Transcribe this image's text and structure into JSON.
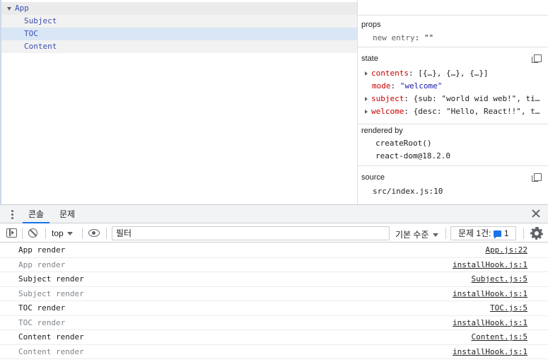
{
  "tree": {
    "root": "App",
    "children": [
      "Subject",
      "TOC",
      "Content"
    ],
    "selected": "TOC"
  },
  "inspector": {
    "props": {
      "title": "props",
      "entries": [
        {
          "key": "new entry",
          "value": "\"\""
        }
      ]
    },
    "state": {
      "title": "state",
      "entries": [
        {
          "key": "contents",
          "value": "[{…}, {…}, {…}]",
          "expandable": true
        },
        {
          "key": "mode",
          "value": "\"welcome\"",
          "expandable": false
        },
        {
          "key": "subject",
          "value": "{sub: \"world wid web!\", title:…",
          "expandable": true
        },
        {
          "key": "welcome",
          "value": "{desc: \"Hello, React!!\", title…",
          "expandable": true
        }
      ]
    },
    "rendered_by": {
      "title": "rendered by",
      "items": [
        "createRoot()",
        "react-dom@18.2.0"
      ]
    },
    "source": {
      "title": "source",
      "value": "src/index.js:10"
    }
  },
  "drawer": {
    "tabs": [
      "콘솔",
      "문제"
    ],
    "active_tab": "콘솔",
    "toolbar": {
      "context": "top",
      "filter_placeholder": "필터",
      "level": "기본 수준",
      "issues_label": "문제 1건:",
      "issues_count": "1"
    },
    "logs": [
      {
        "message": "App render",
        "source": "App.js:22",
        "dim": false
      },
      {
        "message": "App render",
        "source": "installHook.js:1",
        "dim": true
      },
      {
        "message": "Subject render",
        "source": "Subject.js:5",
        "dim": false
      },
      {
        "message": "Subject render",
        "source": "installHook.js:1",
        "dim": true
      },
      {
        "message": "TOC render",
        "source": "TOC.js:5",
        "dim": false
      },
      {
        "message": "TOC render",
        "source": "installHook.js:1",
        "dim": true
      },
      {
        "message": "Content render",
        "source": "Content.js:5",
        "dim": false
      },
      {
        "message": "Content render",
        "source": "installHook.js:1",
        "dim": true
      }
    ]
  },
  "colors": {
    "selected_row": "#d9e6f5",
    "component_name": "#3c4fb3",
    "state_key": "#c80000",
    "string_value": "#1a1aa6",
    "accent": "#1a73e8"
  },
  "icons": [
    "caret-down-icon",
    "copy-icon",
    "kebab-menu-icon",
    "close-icon",
    "sidebar-toggle-icon",
    "clear-console-icon",
    "eye-icon",
    "message-icon",
    "gear-icon"
  ]
}
